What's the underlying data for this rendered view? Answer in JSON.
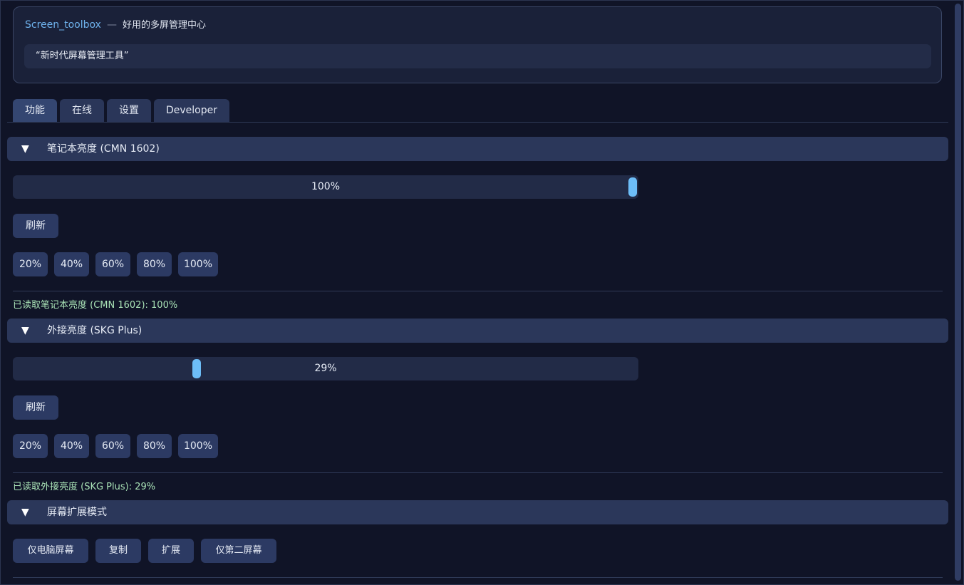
{
  "header": {
    "app_name": "Screen_toolbox",
    "separator": "—",
    "tagline": "好用的多屏管理中心",
    "quote": "“新时代屏幕管理工具”"
  },
  "tabs": [
    {
      "label": "功能",
      "active": true
    },
    {
      "label": "在线",
      "active": false
    },
    {
      "label": "设置",
      "active": false
    },
    {
      "label": "Developer",
      "active": false
    }
  ],
  "laptop": {
    "title": "笔记本亮度 (CMN 1602)",
    "slider_label": "100%",
    "slider_value": 100,
    "refresh_label": "刷新",
    "presets": [
      "20%",
      "40%",
      "60%",
      "80%",
      "100%"
    ],
    "status": "已读取笔记本亮度 (CMN 1602): 100%"
  },
  "external": {
    "title": "外接亮度 (SKG Plus)",
    "slider_label": "29%",
    "slider_value": 29,
    "refresh_label": "刷新",
    "presets": [
      "20%",
      "40%",
      "60%",
      "80%",
      "100%"
    ],
    "status": "已读取外接亮度 (SKG Plus): 29%"
  },
  "projection": {
    "title": "屏幕扩展模式",
    "buttons": [
      "仅电脑屏幕",
      "复制",
      "扩展",
      "仅第二屏幕"
    ]
  },
  "icons": {
    "collapse": "triangle-down-icon",
    "glyph": "▼"
  },
  "colors": {
    "accent": "#6dbdf7",
    "status_text": "#a9e2b6",
    "background": "#101427"
  }
}
